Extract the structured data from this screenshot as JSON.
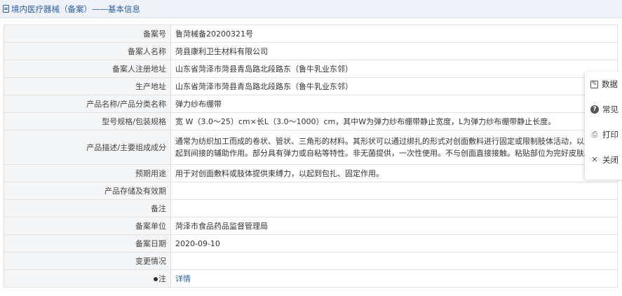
{
  "header": {
    "title": "境内医疗器械（备案）——基本信息",
    "icon": "document-icon"
  },
  "rows": [
    {
      "label": "备案号",
      "value": "鲁菏械备20200321号"
    },
    {
      "label": "备案人名称",
      "value": "菏县康利卫生材料有限公司"
    },
    {
      "label": "备案人注册地址",
      "value": "山东省菏泽市菏县青岛路北段路东（鲁牛乳业东邻）"
    },
    {
      "label": "生产地址",
      "value": "山东省菏泽市菏县青岛路北段路东（鲁牛乳业东邻）"
    },
    {
      "label": "产品名称/产品分类名称",
      "value": "弹力纱布绷带"
    },
    {
      "label": "型号规格/包装规格",
      "value": "宽 W（3.0～25）cm×长L（3.0～1000）cm，其中W为弹力纱布绷带静止宽度，L为弹力纱布绷带静止长度。"
    },
    {
      "label": "产品描述/主要组成成分",
      "value": "通常为纺织加工而成的卷状、管状、三角形的材料。其形状可以通过绑扎的形式对创面敷料进行固定或限制肢体活动，以对创面起到间接的辅助作用。部分具有弹力或自粘等特性。非无菌提供，一次性使用。不与创面直接接触。粘贴部位为完好皮肤。"
    },
    {
      "label": "预期用途",
      "value": "用于对创面敷料或肢体提供束缚力，以起到包扎、固定作用。"
    },
    {
      "label": "产品存储及有效期",
      "value": ""
    },
    {
      "label": "备注",
      "value": ""
    },
    {
      "label": "备案单位",
      "value": "菏泽市食品药品监督管理局"
    },
    {
      "label": "备案日期",
      "value": "2020-09-10"
    },
    {
      "label": "变更情况",
      "value": ""
    }
  ],
  "note_row": {
    "label": "注",
    "link_text": "详情"
  },
  "side_panel": {
    "items": [
      {
        "label": "数据",
        "icon": "edit-icon"
      },
      {
        "label": "常见",
        "icon": "help-icon"
      },
      {
        "label": "打印",
        "icon": "print-icon"
      },
      {
        "label": "关闭",
        "icon": "close-icon"
      }
    ]
  },
  "colors": {
    "accent": "#2a5ea8",
    "label_bg": "#f4f5f7",
    "header_bg": "#eef2f7"
  }
}
